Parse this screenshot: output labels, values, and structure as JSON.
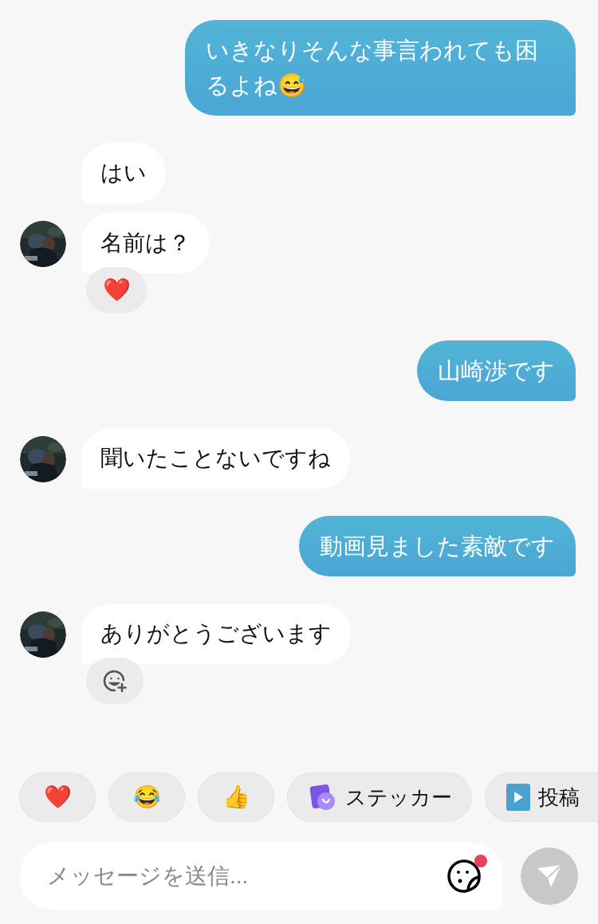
{
  "messages": [
    {
      "kind": "sent",
      "text": "いきなりそんな事言われても困るよね😅"
    },
    {
      "kind": "received",
      "text": "はい",
      "avatar": false
    },
    {
      "kind": "received",
      "text": "名前は？",
      "avatar": true,
      "reaction": {
        "kind": "emoji",
        "text": "❤️"
      }
    },
    {
      "kind": "sent",
      "text": "山崎渉です"
    },
    {
      "kind": "received",
      "text": "聞いたことないですね",
      "avatar": true
    },
    {
      "kind": "sent",
      "text": "動画見ました素敵です"
    },
    {
      "kind": "received",
      "text": "ありがとうございます",
      "avatar": true,
      "reaction": {
        "kind": "add"
      }
    }
  ],
  "quick_actions": [
    {
      "kind": "emoji",
      "text": "❤️"
    },
    {
      "kind": "emoji",
      "text": "😂"
    },
    {
      "kind": "emoji",
      "text": "👍"
    },
    {
      "kind": "sticker",
      "text": "ステッカー"
    },
    {
      "kind": "post",
      "text": "投稿"
    }
  ],
  "composer": {
    "placeholder": "メッセージを送信...",
    "sticker_badge": true
  }
}
